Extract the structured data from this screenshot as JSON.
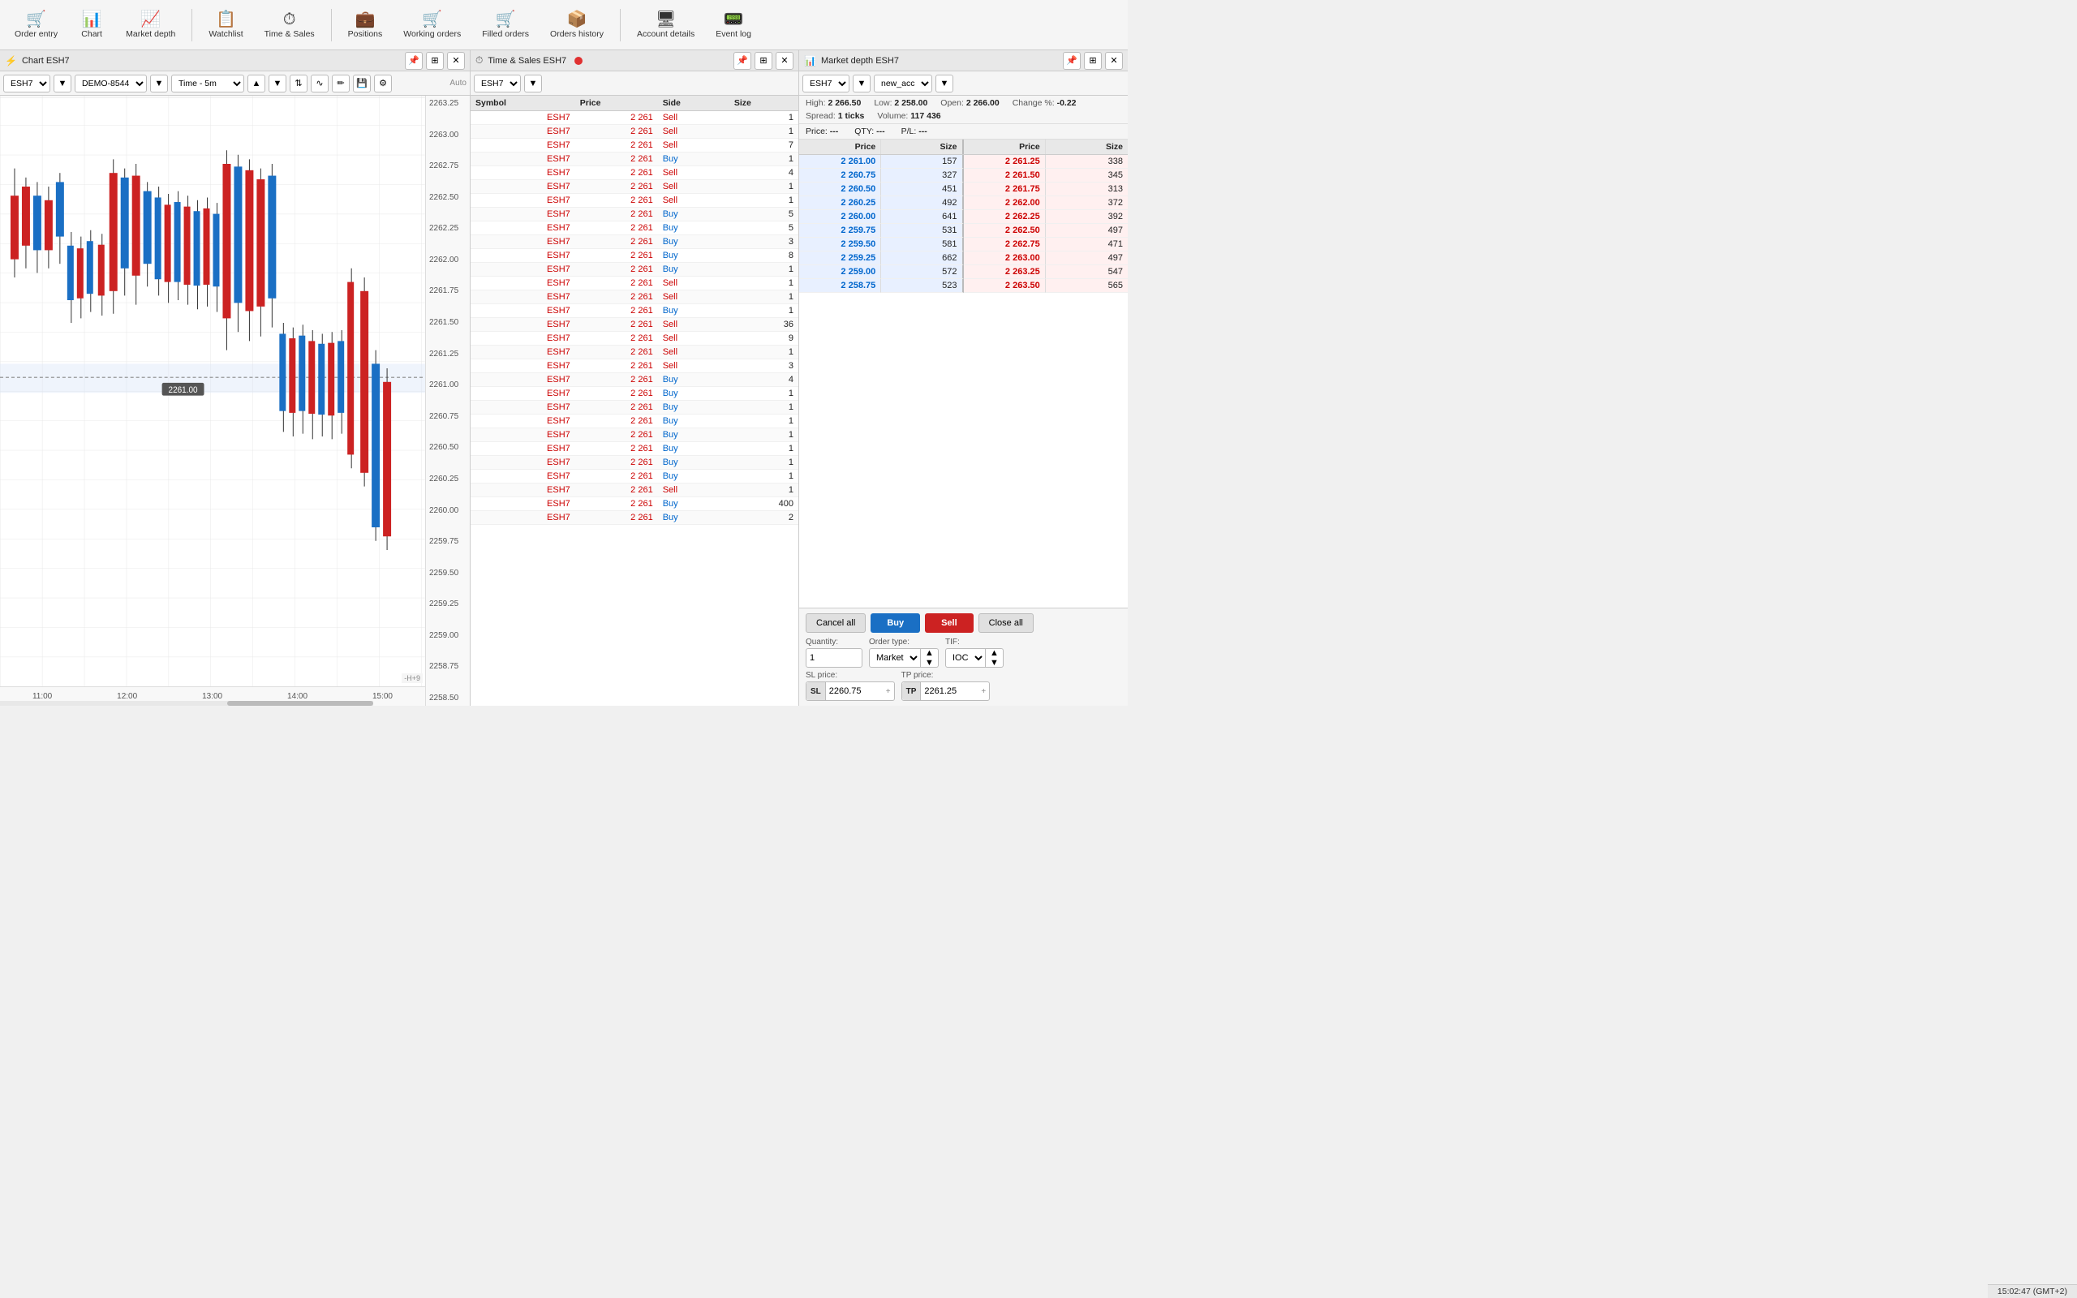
{
  "toolbar": {
    "items": [
      {
        "id": "order-entry",
        "icon": "🛒",
        "label": "Order entry"
      },
      {
        "id": "chart",
        "icon": "📊",
        "label": "Chart"
      },
      {
        "id": "market-depth",
        "icon": "📈",
        "label": "Market depth"
      },
      {
        "separator": true
      },
      {
        "id": "watchlist",
        "icon": "📋",
        "label": "Watchlist"
      },
      {
        "id": "time-sales",
        "icon": "⏱",
        "label": "Time & Sales"
      },
      {
        "separator": true
      },
      {
        "id": "positions",
        "icon": "💼",
        "label": "Positions"
      },
      {
        "id": "working-orders",
        "icon": "🛒",
        "label": "Working orders"
      },
      {
        "id": "filled-orders",
        "icon": "🛒",
        "label": "Filled orders"
      },
      {
        "id": "orders-history",
        "icon": "📦",
        "label": "Orders history"
      },
      {
        "separator": true
      },
      {
        "id": "account-details",
        "icon": "🖥",
        "label": "Account details"
      },
      {
        "id": "event-log",
        "icon": "📟",
        "label": "Event log"
      }
    ]
  },
  "chart": {
    "panel_title": "Chart ESH7",
    "symbol": "ESH7",
    "account": "DEMO-8544",
    "timeframe": "Time - 5m",
    "price_levels": [
      "2263.25",
      "2263.00",
      "2262.75",
      "2262.50",
      "2262.25",
      "2262.00",
      "2261.75",
      "2261.50",
      "2261.25",
      "2261.00",
      "2260.75",
      "2260.50",
      "2260.25",
      "2260.00",
      "2259.75",
      "2259.50",
      "2259.25",
      "2259.00",
      "2258.75",
      "2258.50"
    ],
    "time_labels": [
      "11:00",
      "12:00",
      "13:00",
      "14:00",
      "15:00"
    ],
    "current_price": "2261.00",
    "highlight_price": "2261.25"
  },
  "time_sales": {
    "panel_title": "Time & Sales ESH7",
    "symbol_input": "ESH7",
    "columns": [
      "Symbol",
      "Price",
      "Side",
      "Size"
    ],
    "rows": [
      [
        "ESH7",
        "2 261",
        "Sell",
        "1"
      ],
      [
        "ESH7",
        "2 261",
        "Sell",
        "1"
      ],
      [
        "ESH7",
        "2 261",
        "Sell",
        "7"
      ],
      [
        "ESH7",
        "2 261",
        "Buy",
        "1"
      ],
      [
        "ESH7",
        "2 261",
        "Sell",
        "4"
      ],
      [
        "ESH7",
        "2 261",
        "Sell",
        "1"
      ],
      [
        "ESH7",
        "2 261",
        "Sell",
        "1"
      ],
      [
        "ESH7",
        "2 261",
        "Buy",
        "5"
      ],
      [
        "ESH7",
        "2 261",
        "Buy",
        "5"
      ],
      [
        "ESH7",
        "2 261",
        "Buy",
        "3"
      ],
      [
        "ESH7",
        "2 261",
        "Buy",
        "8"
      ],
      [
        "ESH7",
        "2 261",
        "Buy",
        "1"
      ],
      [
        "ESH7",
        "2 261",
        "Sell",
        "1"
      ],
      [
        "ESH7",
        "2 261",
        "Sell",
        "1"
      ],
      [
        "ESH7",
        "2 261",
        "Buy",
        "1"
      ],
      [
        "ESH7",
        "2 261",
        "Sell",
        "36"
      ],
      [
        "ESH7",
        "2 261",
        "Sell",
        "9"
      ],
      [
        "ESH7",
        "2 261",
        "Sell",
        "1"
      ],
      [
        "ESH7",
        "2 261",
        "Sell",
        "3"
      ],
      [
        "ESH7",
        "2 261",
        "Buy",
        "4"
      ],
      [
        "ESH7",
        "2 261",
        "Buy",
        "1"
      ],
      [
        "ESH7",
        "2 261",
        "Buy",
        "1"
      ],
      [
        "ESH7",
        "2 261",
        "Buy",
        "1"
      ],
      [
        "ESH7",
        "2 261",
        "Buy",
        "1"
      ],
      [
        "ESH7",
        "2 261",
        "Buy",
        "1"
      ],
      [
        "ESH7",
        "2 261",
        "Buy",
        "1"
      ],
      [
        "ESH7",
        "2 261",
        "Buy",
        "1"
      ],
      [
        "ESH7",
        "2 261",
        "Sell",
        "1"
      ],
      [
        "ESH7",
        "2 261",
        "Buy",
        "400"
      ],
      [
        "ESH7",
        "2 261",
        "Buy",
        "2"
      ]
    ]
  },
  "market_depth": {
    "panel_title": "Market depth ESH7",
    "symbol": "ESH7",
    "account": "new_acc",
    "high": "2 266.50",
    "low": "2 258.00",
    "open": "2 266.00",
    "change_pct": "-0.22",
    "spread": "1 ticks",
    "volume": "117 436",
    "price_label": "Price:",
    "price_value": "---",
    "qty_label": "QTY:",
    "qty_value": "---",
    "pl_label": "P/L:",
    "pl_value": "---",
    "bid_columns": [
      "Price",
      "Size"
    ],
    "ask_columns": [
      "Price",
      "Size"
    ],
    "bids": [
      [
        "2 261.00",
        "157"
      ],
      [
        "2 260.75",
        "327"
      ],
      [
        "2 260.50",
        "451"
      ],
      [
        "2 260.25",
        "492"
      ],
      [
        "2 260.00",
        "641"
      ],
      [
        "2 259.75",
        "531"
      ],
      [
        "2 259.50",
        "581"
      ],
      [
        "2 259.25",
        "662"
      ],
      [
        "2 259.00",
        "572"
      ],
      [
        "2 258.75",
        "523"
      ]
    ],
    "asks": [
      [
        "2 261.25",
        "338"
      ],
      [
        "2 261.50",
        "345"
      ],
      [
        "2 261.75",
        "313"
      ],
      [
        "2 262.00",
        "372"
      ],
      [
        "2 262.25",
        "392"
      ],
      [
        "2 262.50",
        "497"
      ],
      [
        "2 262.75",
        "471"
      ],
      [
        "2 263.00",
        "497"
      ],
      [
        "2 263.25",
        "547"
      ],
      [
        "2 263.50",
        "565"
      ]
    ],
    "buttons": {
      "cancel_all": "Cancel all",
      "buy": "Buy",
      "sell": "Sell",
      "close_all": "Close all"
    },
    "order_form": {
      "quantity_label": "Quantity:",
      "quantity_value": "1",
      "order_type_label": "Order type:",
      "order_type_value": "Market",
      "tif_label": "TIF:",
      "tif_value": "IOC",
      "sl_price_label": "SL price:",
      "sl_prefix": "SL",
      "sl_value": "2260.75",
      "sl_suffix": "+",
      "tp_price_label": "TP price:",
      "tp_prefix": "TP",
      "tp_value": "2261.25",
      "tp_suffix": "+"
    }
  },
  "statusbar": {
    "time": "15:02:47 (GMT+2)"
  }
}
